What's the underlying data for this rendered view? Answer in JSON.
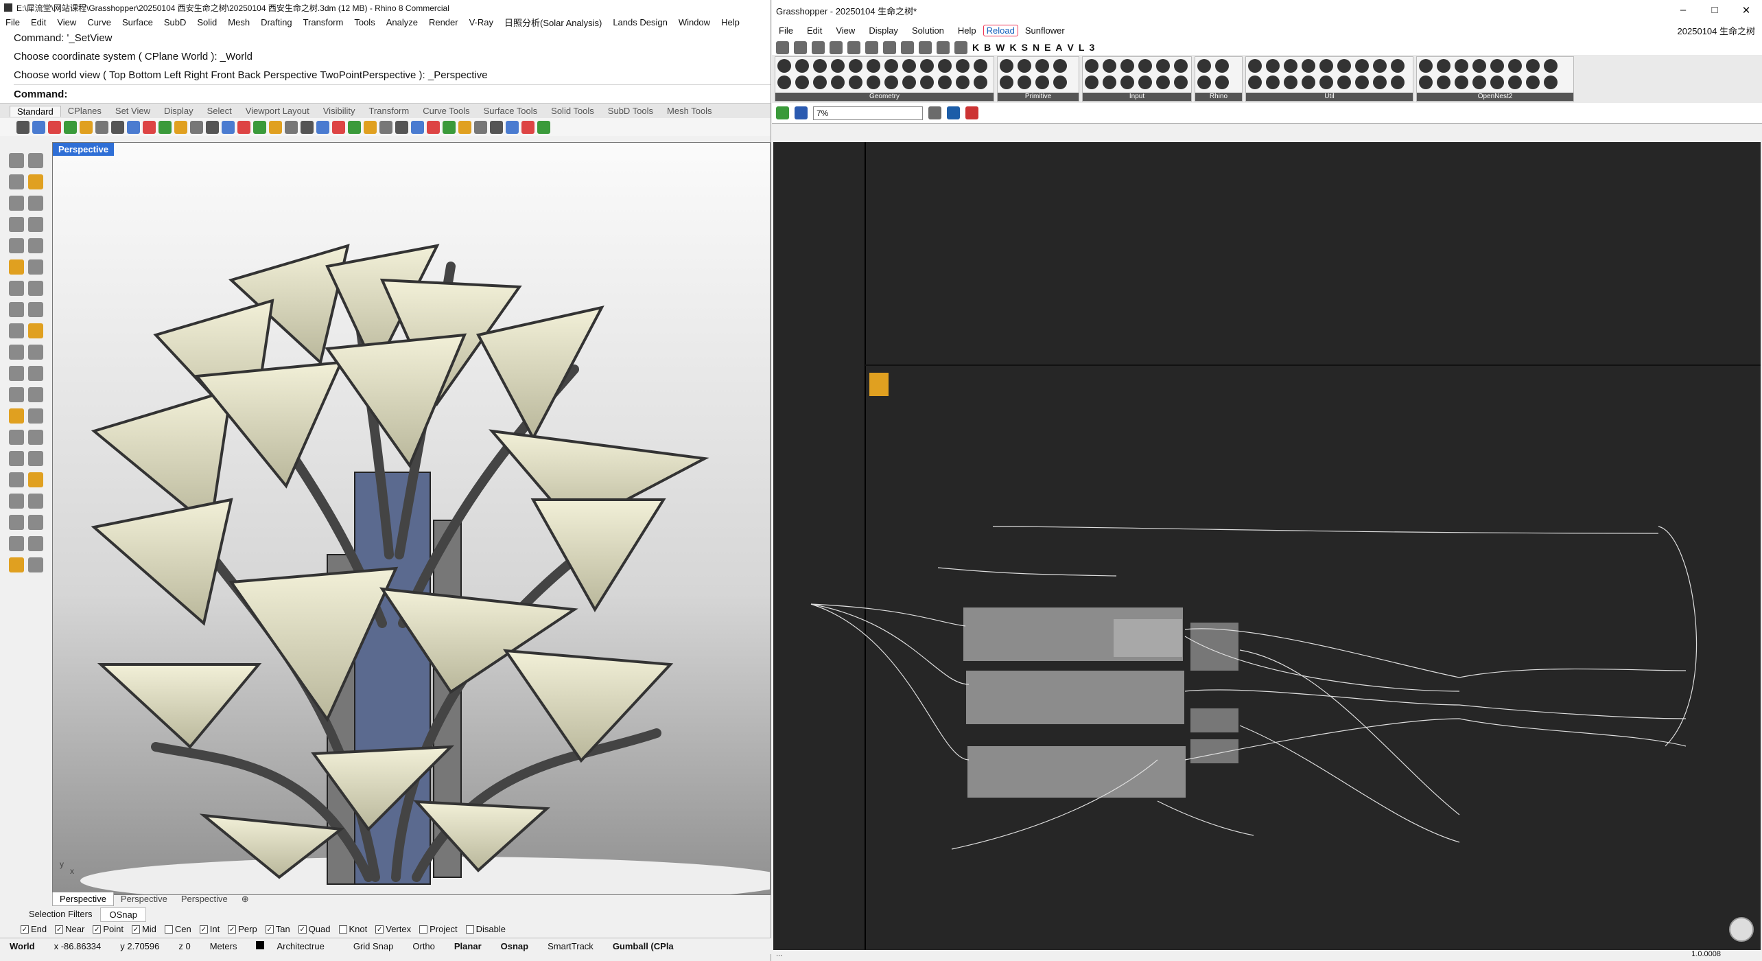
{
  "rhino": {
    "title": "E:\\犀流堂\\网站课程\\Grasshopper\\20250104 西安生命之树\\20250104 西安生命之树.3dm (12 MB) - Rhino 8 Commercial",
    "menu": [
      "File",
      "Edit",
      "View",
      "Curve",
      "Surface",
      "SubD",
      "Solid",
      "Mesh",
      "Drafting",
      "Transform",
      "Tools",
      "Analyze",
      "Render",
      "V-Ray",
      "日照分析(Solar Analysis)",
      "Lands Design",
      "Window",
      "Help"
    ],
    "command_history": [
      "Command: '_SetView",
      "Choose coordinate system ( CPlane  World ): _World",
      "Choose world view ( Top  Bottom  Left  Right  Front  Back  Perspective  TwoPointPerspective ): _Perspective"
    ],
    "command_prompt": "Command:",
    "toolbar_tabs": [
      "Standard",
      "CPlanes",
      "Set View",
      "Display",
      "Select",
      "Viewport Layout",
      "Visibility",
      "Transform",
      "Curve Tools",
      "Surface Tools",
      "Solid Tools",
      "SubD Tools",
      "Mesh Tools"
    ],
    "viewport_label": "Perspective",
    "viewport_tabs": [
      "Perspective",
      "Perspective",
      "Perspective"
    ],
    "panel_tabs": [
      "Selection Filters",
      "OSnap"
    ],
    "osnap": [
      {
        "label": "End",
        "checked": true
      },
      {
        "label": "Near",
        "checked": true
      },
      {
        "label": "Point",
        "checked": true
      },
      {
        "label": "Mid",
        "checked": true
      },
      {
        "label": "Cen",
        "checked": false
      },
      {
        "label": "Int",
        "checked": true
      },
      {
        "label": "Perp",
        "checked": true
      },
      {
        "label": "Tan",
        "checked": true
      },
      {
        "label": "Quad",
        "checked": true
      },
      {
        "label": "Knot",
        "checked": false
      },
      {
        "label": "Vertex",
        "checked": true
      },
      {
        "label": "Project",
        "checked": false
      },
      {
        "label": "Disable",
        "checked": false
      }
    ],
    "status": {
      "world": "World",
      "x": "x -86.86334",
      "y": "y 2.70596",
      "z": "z 0",
      "units": "Meters",
      "layer": "Architectrue",
      "grid_snap": "Grid Snap",
      "ortho": "Ortho",
      "planar": "Planar",
      "osnap": "Osnap",
      "smarttrack": "SmartTrack",
      "gumball": "Gumball (CPla"
    }
  },
  "gh": {
    "title": "Grasshopper - 20250104 生命之树*",
    "doc_name": "20250104 生命之树",
    "menu": [
      "File",
      "Edit",
      "View",
      "Display",
      "Solution",
      "Help",
      "Reload",
      "Sunflower"
    ],
    "tab_letters": [
      "K",
      "B",
      "W",
      "K",
      "S",
      "N",
      "E",
      "A",
      "V",
      "L",
      "3"
    ],
    "panels": [
      "Geometry",
      "Primitive",
      "Input",
      "Rhino",
      "Util",
      "OpenNest2"
    ],
    "zoom": "7%",
    "status_version": "1.0.0008"
  }
}
